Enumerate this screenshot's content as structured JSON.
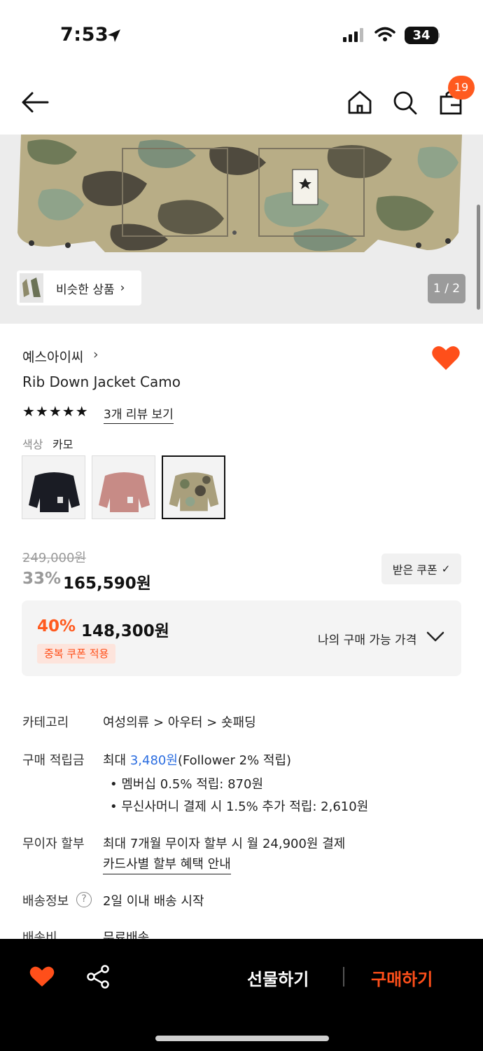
{
  "status_bar": {
    "time": "7:53",
    "battery": "34"
  },
  "header": {
    "cart_count": "19"
  },
  "gallery": {
    "similar_label": "비슷한 상품",
    "page_indicator": "1 / 2"
  },
  "product": {
    "brand": "예스아이씨",
    "name": "Rib Down Jacket Camo",
    "stars": "★★★★★",
    "review_link": "3개 리뷰 보기",
    "color_label": "색상",
    "color_value": "카모",
    "swatches": [
      "black",
      "pink",
      "camo"
    ]
  },
  "price": {
    "original": "249,000원",
    "discount_rate": "33%",
    "sale_price": "165,590원",
    "coupon_button": "받은 쿠폰",
    "best_rate": "40%",
    "best_price": "148,300원",
    "dup_coupon_tag": "중복 쿠폰 적용",
    "my_price_link": "나의 구매 가능 가격"
  },
  "info": {
    "category_label": "카테고리",
    "category_value": "여성의류 > 아우터 > 숏패딩",
    "points_label": "구매 적립금",
    "points_prefix": "최대 ",
    "points_amount": "3,480원",
    "points_suffix": "(Follower 2% 적립)",
    "points_bullet_1": "•  멤버십 0.5% 적립: 870원",
    "points_bullet_2": "•  무신사머니 결제 시 1.5% 추가 적립: 2,610원",
    "installment_label": "무이자 할부",
    "installment_value": "최대 7개월 무이자 할부 시 월 24,900원 결제",
    "installment_link": "카드사별 할부 혜택 안내",
    "shipping_label": "배송정보",
    "shipping_value": "2일 이내 배송 시작",
    "shipping_fee_label": "배송비",
    "shipping_fee_value": "무료배송"
  },
  "bottom_bar": {
    "gift": "선물하기",
    "buy": "구매하기"
  },
  "colors": {
    "accent": "#ff5a1f",
    "link": "#2b6de0"
  }
}
